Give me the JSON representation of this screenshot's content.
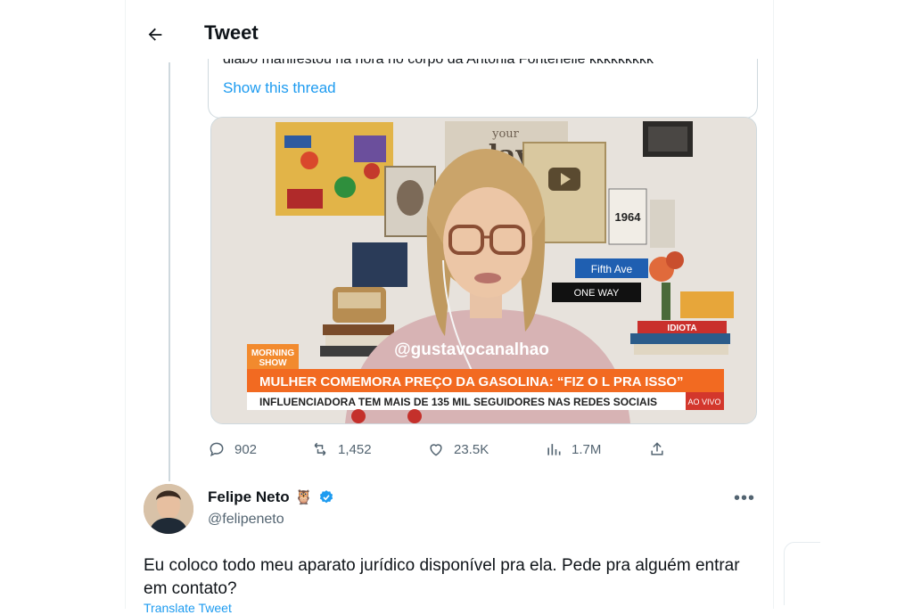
{
  "header": {
    "back_icon": "arrow-left-icon",
    "title": "Tweet"
  },
  "quoted": {
    "cut_text": "diabo manifestou na hora no corpo da Antonia Fontenelle kkkkkkkkk",
    "show_thread": "Show this thread"
  },
  "media": {
    "poster_big": "day",
    "poster_small": "your",
    "book_year": "1964",
    "sign_fifth": "Fifth Ave",
    "sign_oneway": "ONE WAY",
    "book_idiota": "IDIOTA",
    "watermark": "@gustavocanalhao",
    "logo_line1": "MORNING",
    "logo_line2": "SHOW",
    "headline": "MULHER COMEMORA PREÇO DA GASOLINA: “FIZ O L PRA ISSO”",
    "subheadline": "INFLUENCIADORA TEM MAIS DE 135 MIL SEGUIDORES NAS REDES SOCIAIS",
    "live_tag": "AO VIVO"
  },
  "actions": {
    "replies": "902",
    "retweets": "1,452",
    "likes": "23.5K",
    "views": "1.7M"
  },
  "reply": {
    "name": "Felipe Neto",
    "emoji": "🦉",
    "handle": "@felipeneto",
    "text": "Eu coloco todo meu aparato jurídico disponível pra ela. Pede pra alguém entrar em contato?",
    "translate": "Translate Tweet"
  },
  "colors": {
    "accent": "#1d9bf0",
    "muted": "#536471",
    "banner_orange": "#f26a21"
  }
}
